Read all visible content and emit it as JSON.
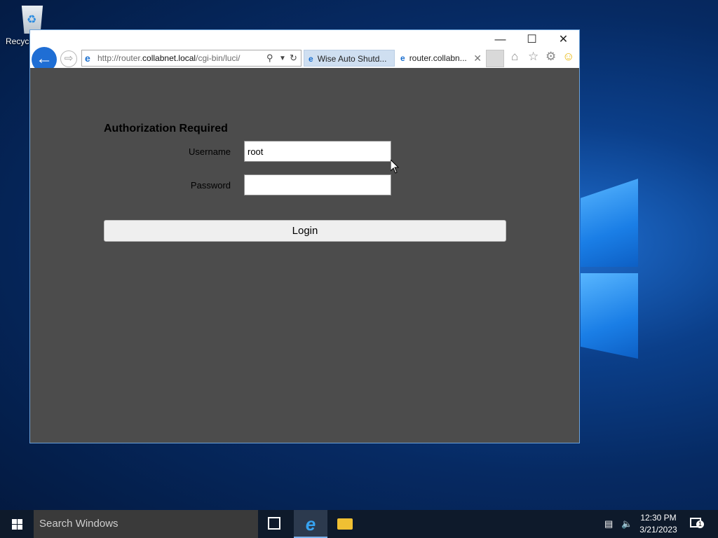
{
  "desktop": {
    "recycle_bin_label": "Recycl"
  },
  "window": {
    "controls": {
      "minimize": "—",
      "maximize": "☐",
      "close": "✕"
    },
    "address": {
      "url_prefix": "http://router.",
      "url_host": "collabnet.local",
      "url_path": "/cgi-bin/luci/"
    },
    "tabs": [
      {
        "label": "Wise Auto Shutd..."
      },
      {
        "label": "router.collabn..."
      }
    ]
  },
  "page": {
    "title": "Authorization Required",
    "username_label": "Username",
    "username_value": "root",
    "password_label": "Password",
    "password_value": "",
    "login_label": "Login"
  },
  "taskbar": {
    "search_placeholder": "Search Windows",
    "time": "12:30 PM",
    "date": "3/21/2023",
    "notification_count": "1"
  },
  "colors": {
    "page_background": "#4c4c4c",
    "taskbar": "#0e1a2b",
    "accent": "#1f6ed4"
  }
}
